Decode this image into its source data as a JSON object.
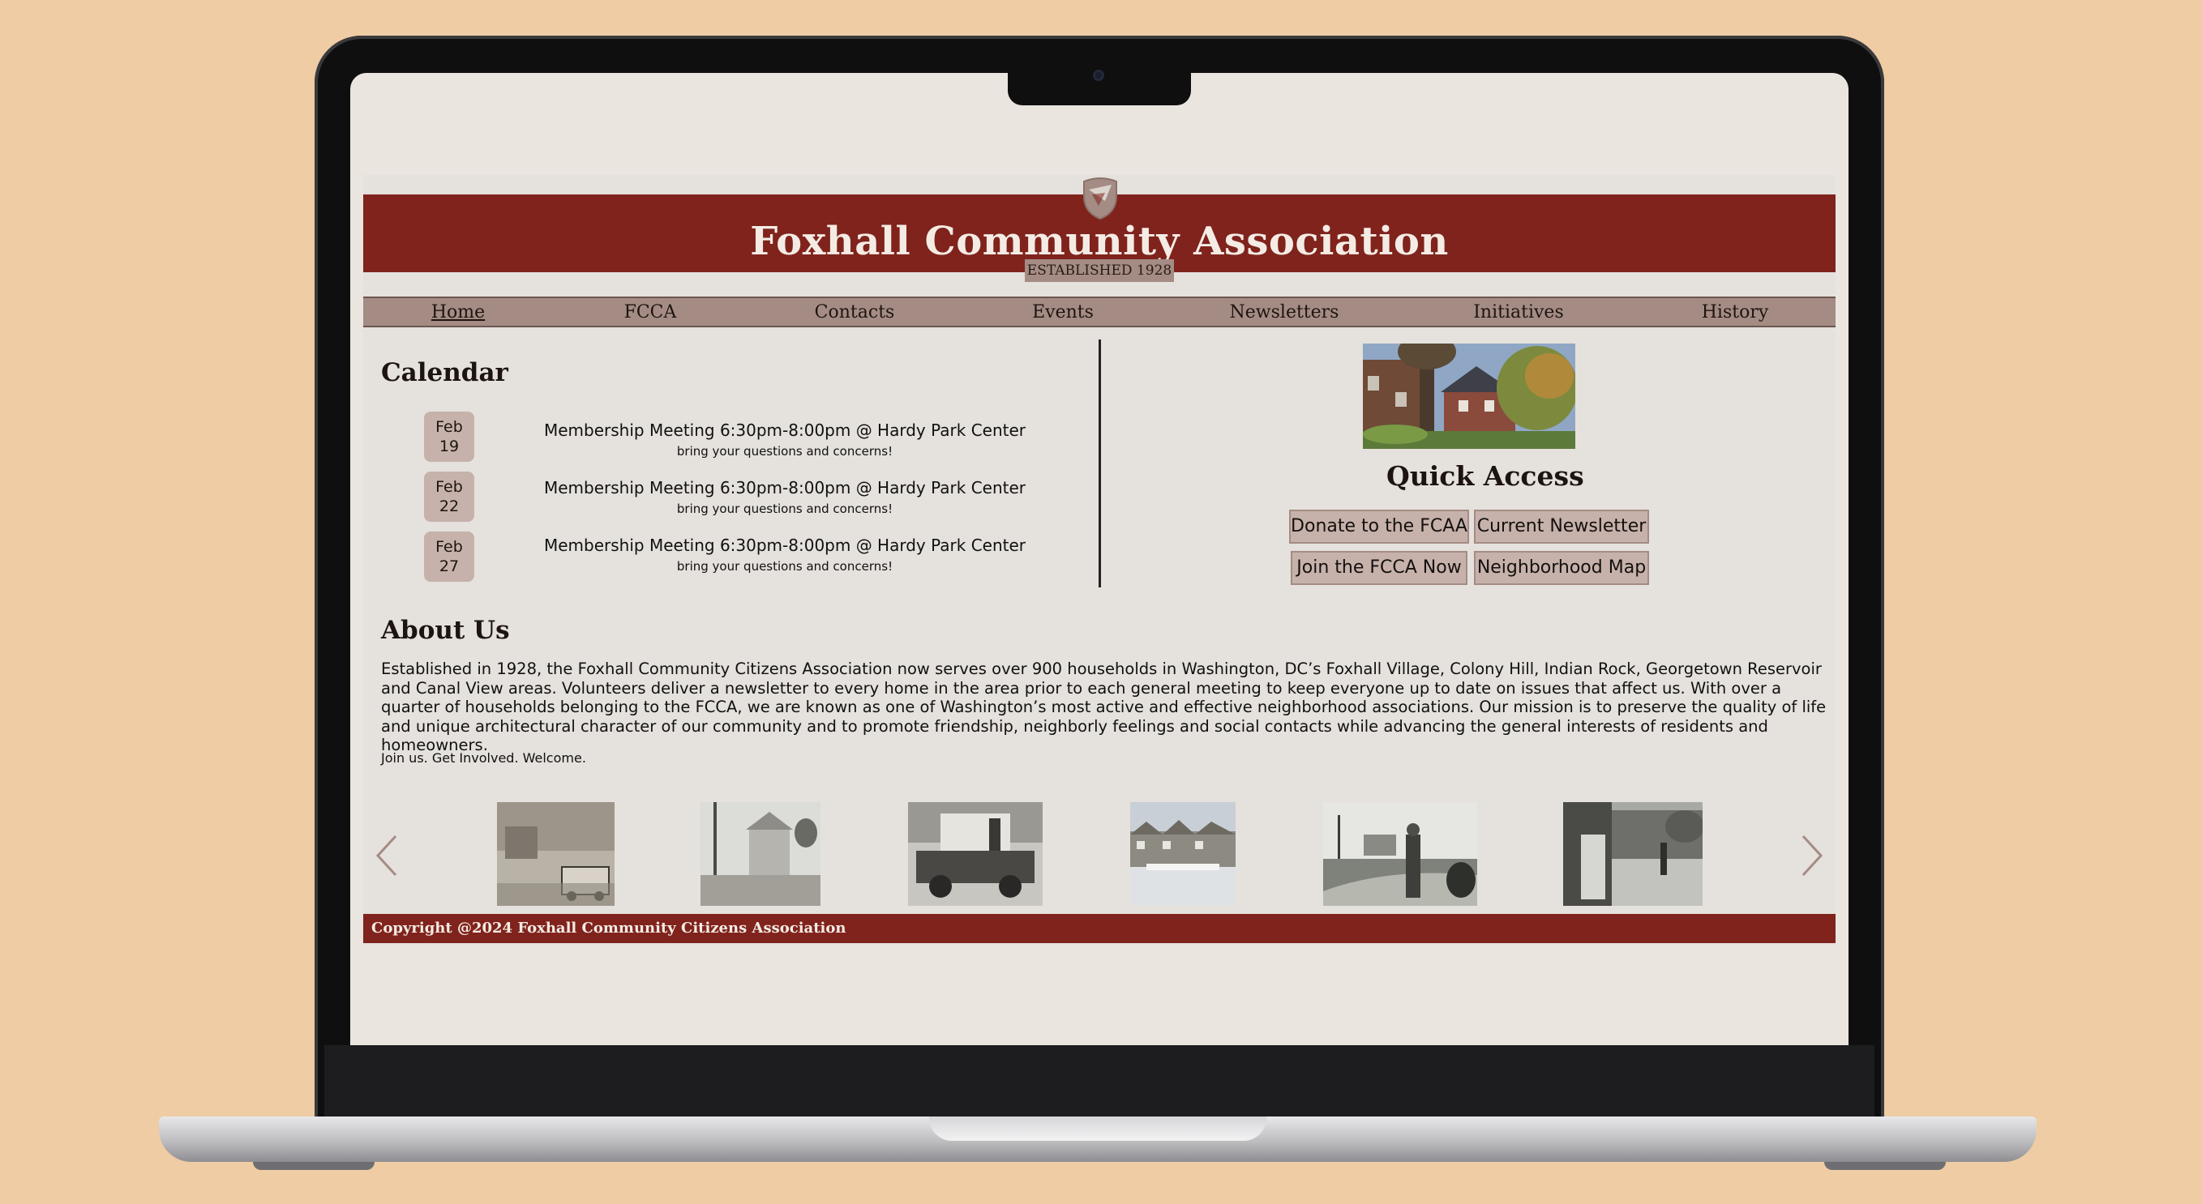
{
  "site": {
    "title": "Foxhall Community Association",
    "established": "ESTABLISHED 1928"
  },
  "nav": {
    "items": [
      "Home",
      "FCCA",
      "Contacts",
      "Events",
      "Newsletters",
      "Initiatives",
      "History"
    ],
    "active": "Home"
  },
  "calendar": {
    "title": "Calendar",
    "events": [
      {
        "month": "Feb",
        "day": "19",
        "title": "Membership Meeting 6:30pm-8:00pm @ Hardy Park Center",
        "note": "bring your questions and concerns!"
      },
      {
        "month": "Feb",
        "day": "22",
        "title": "Membership Meeting 6:30pm-8:00pm @ Hardy Park Center",
        "note": "bring your questions and concerns!"
      },
      {
        "month": "Feb",
        "day": "27",
        "title": "Membership Meeting 6:30pm-8:00pm @ Hardy Park Center",
        "note": "bring your questions and concerns!"
      }
    ]
  },
  "quick_access": {
    "title": "Quick Access",
    "buttons": [
      "Donate to the FCAA",
      "Current Newsletter",
      "Join the FCCA Now",
      "Neighborhood Map"
    ]
  },
  "about": {
    "title": "About Us",
    "text": "Established in 1928, the Foxhall Community Citizens Association now serves over 900 households in Washington, DC’s Foxhall Village, Colony Hill, Indian Rock, Georgetown Reservoir and Canal View areas. Volunteers deliver a newsletter to every home in the area prior to each general meeting to keep everyone up to date on issues that affect us. With over a quarter of households belonging to the FCCA, we are known as one of Washington’s most active and effective neighborhood associations. Our mission is to preserve the quality of life and unique architectural character of our community and to promote friendship, neighborly feelings and social contacts while advancing the general interests of residents and homeowners.",
    "tagline": "Join us. Get Involved. Welcome."
  },
  "footer": {
    "copyright": "Copyright @2024 Foxhall Community Citizens Association"
  },
  "colors": {
    "brand": "#80231d",
    "nav": "#a48c84",
    "button": "#c6b2aa",
    "page_bg": "#e5e1dc",
    "backdrop": "#efcca4"
  },
  "icons": [
    "shield-icon",
    "chevron-left-icon",
    "chevron-right-icon"
  ]
}
